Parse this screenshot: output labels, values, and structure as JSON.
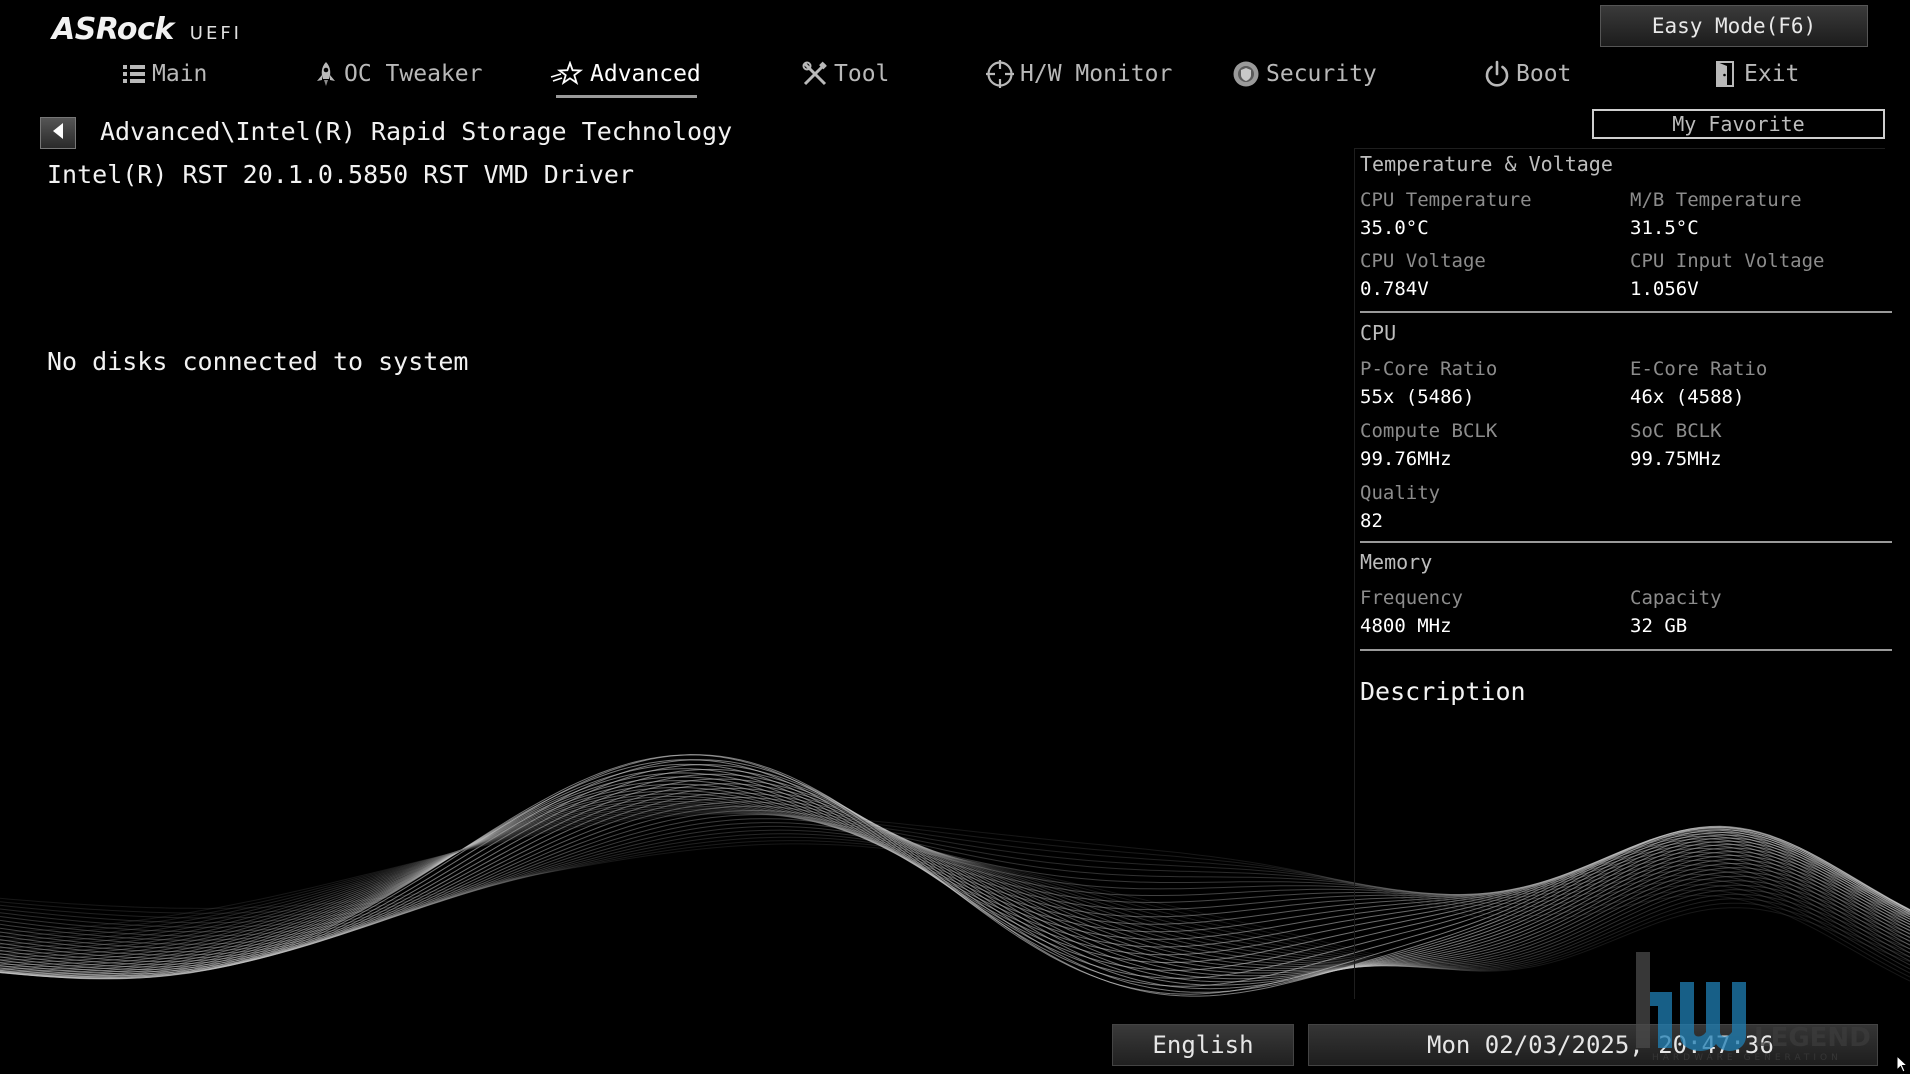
{
  "header": {
    "brand": "ASRock",
    "brand_sub": "UEFI",
    "easy_mode_label": "Easy Mode(F6)",
    "favorite_label": "My Favorite"
  },
  "nav": {
    "tabs": [
      {
        "label": "Main",
        "icon": "list-icon",
        "active": false
      },
      {
        "label": "OC Tweaker",
        "icon": "rocket-icon",
        "active": false
      },
      {
        "label": "Advanced",
        "icon": "star-icon",
        "active": true
      },
      {
        "label": "Tool",
        "icon": "tools-icon",
        "active": false
      },
      {
        "label": "H/W Monitor",
        "icon": "crosshair-icon",
        "active": false
      },
      {
        "label": "Security",
        "icon": "shield-icon",
        "active": false
      },
      {
        "label": "Boot",
        "icon": "power-icon",
        "active": false
      },
      {
        "label": "Exit",
        "icon": "exit-door-icon",
        "active": false
      }
    ]
  },
  "main": {
    "breadcrumb": "Advanced\\Intel(R) Rapid Storage Technology",
    "driver_info": "Intel(R) RST 20.1.0.5850 RST VMD Driver",
    "status_message": "No disks connected to system"
  },
  "panel": {
    "temp_voltage": {
      "title": "Temperature & Voltage",
      "cpu_temp_label": "CPU Temperature",
      "cpu_temp_value": "35.0°C",
      "mb_temp_label": "M/B Temperature",
      "mb_temp_value": "31.5°C",
      "cpu_voltage_label": "CPU Voltage",
      "cpu_voltage_value": "0.784V",
      "cpu_input_voltage_label": "CPU Input Voltage",
      "cpu_input_voltage_value": "1.056V"
    },
    "cpu": {
      "title": "CPU",
      "pcore_label": "P-Core Ratio",
      "pcore_value": "55x (5486)",
      "ecore_label": "E-Core Ratio",
      "ecore_value": "46x (4588)",
      "compute_bclk_label": "Compute BCLK",
      "compute_bclk_value": "99.76MHz",
      "soc_bclk_label": "SoC BCLK",
      "soc_bclk_value": "99.75MHz",
      "quality_label": "Quality",
      "quality_value": "82"
    },
    "memory": {
      "title": "Memory",
      "frequency_label": "Frequency",
      "frequency_value": "4800 MHz",
      "capacity_label": "Capacity",
      "capacity_value": "32 GB"
    },
    "description_title": "Description"
  },
  "footer": {
    "language": "English",
    "datetime": "Mon 02/03/2025, 20:47:36"
  },
  "watermark": {
    "text": "LEGEND",
    "subtext": "HARDWARE GENERATION"
  },
  "colors": {
    "background": "#000000",
    "text": "#f2f2f2",
    "label": "#8c8c8c",
    "tab_inactive": "#b9b9b9",
    "divider": "#9a9a9a",
    "watermark_blue": "#1f7fb4"
  }
}
